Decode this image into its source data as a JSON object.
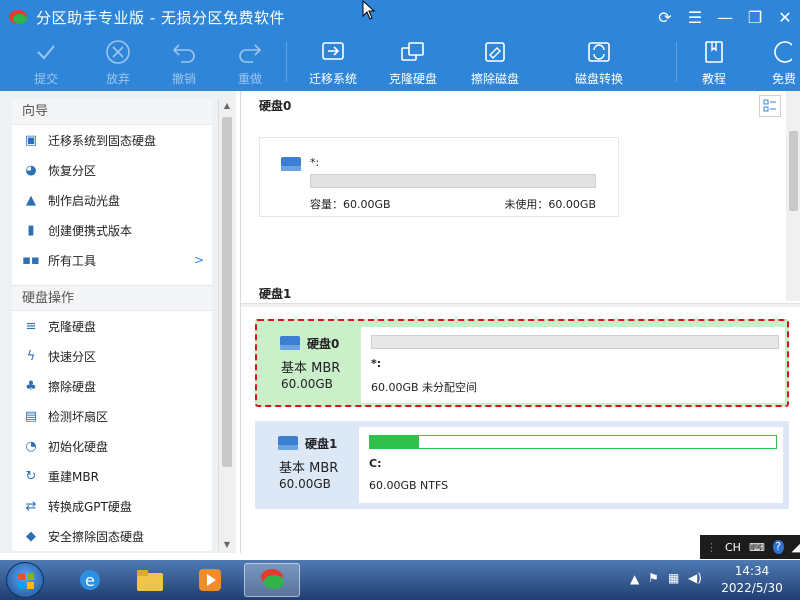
{
  "window": {
    "title": "分区助手专业版 - 无损分区免费软件",
    "controls": [
      "refresh-icon",
      "menu-icon",
      "minimize-icon",
      "restore-icon",
      "close-icon"
    ]
  },
  "toolbar": {
    "commit": "提交",
    "discard": "放弃",
    "undo": "撤销",
    "redo": "重做",
    "migrate_os": "迁移系统",
    "clone_disk": "克隆硬盘",
    "wipe_disk": "擦除磁盘",
    "disk_convert": "磁盘转换",
    "tutorial": "教程",
    "free": "免费"
  },
  "sidebar": {
    "wizard_title": "向导",
    "wizard_items": [
      {
        "label": "迁移系统到固态硬盘",
        "icon": "migrate-icon"
      },
      {
        "label": "恢复分区",
        "icon": "pie-icon"
      },
      {
        "label": "制作启动光盘",
        "icon": "person-icon"
      },
      {
        "label": "创建便携式版本",
        "icon": "usb-icon"
      },
      {
        "label": "所有工具",
        "icon": "grid-icon"
      }
    ],
    "disk_ops_title": "硬盘操作",
    "disk_ops_items": [
      {
        "label": "克隆硬盘",
        "icon": "clone-icon"
      },
      {
        "label": "快速分区",
        "icon": "bolt-icon"
      },
      {
        "label": "擦除硬盘",
        "icon": "broom-icon"
      },
      {
        "label": "检测坏扇区",
        "icon": "scan-icon"
      },
      {
        "label": "初始化硬盘",
        "icon": "init-icon"
      },
      {
        "label": "重建MBR",
        "icon": "rebuild-icon"
      },
      {
        "label": "转换成GPT硬盘",
        "icon": "convert-icon"
      },
      {
        "label": "安全擦除固态硬盘",
        "icon": "eraser-icon"
      }
    ]
  },
  "top_view": {
    "disk0_header": "硬盘0",
    "disk1_header": "硬盘1",
    "card": {
      "label": "*:",
      "capacity": "容量：60.00GB",
      "unused": "未使用：60.00GB"
    }
  },
  "disks": [
    {
      "name": "硬盘0",
      "type": "基本 MBR",
      "size": "60.00GB",
      "partition_label": "*:",
      "partition_desc": "60.00GB 未分配空间",
      "used_fraction": 0
    },
    {
      "name": "硬盘1",
      "type": "基本 MBR",
      "size": "60.00GB",
      "partition_label": "C:",
      "partition_desc": "60.00GB NTFS",
      "used_fraction": 0.12
    }
  ],
  "taskbar": {
    "lang": "CH",
    "time": "14:34",
    "date": "2022/5/30"
  }
}
